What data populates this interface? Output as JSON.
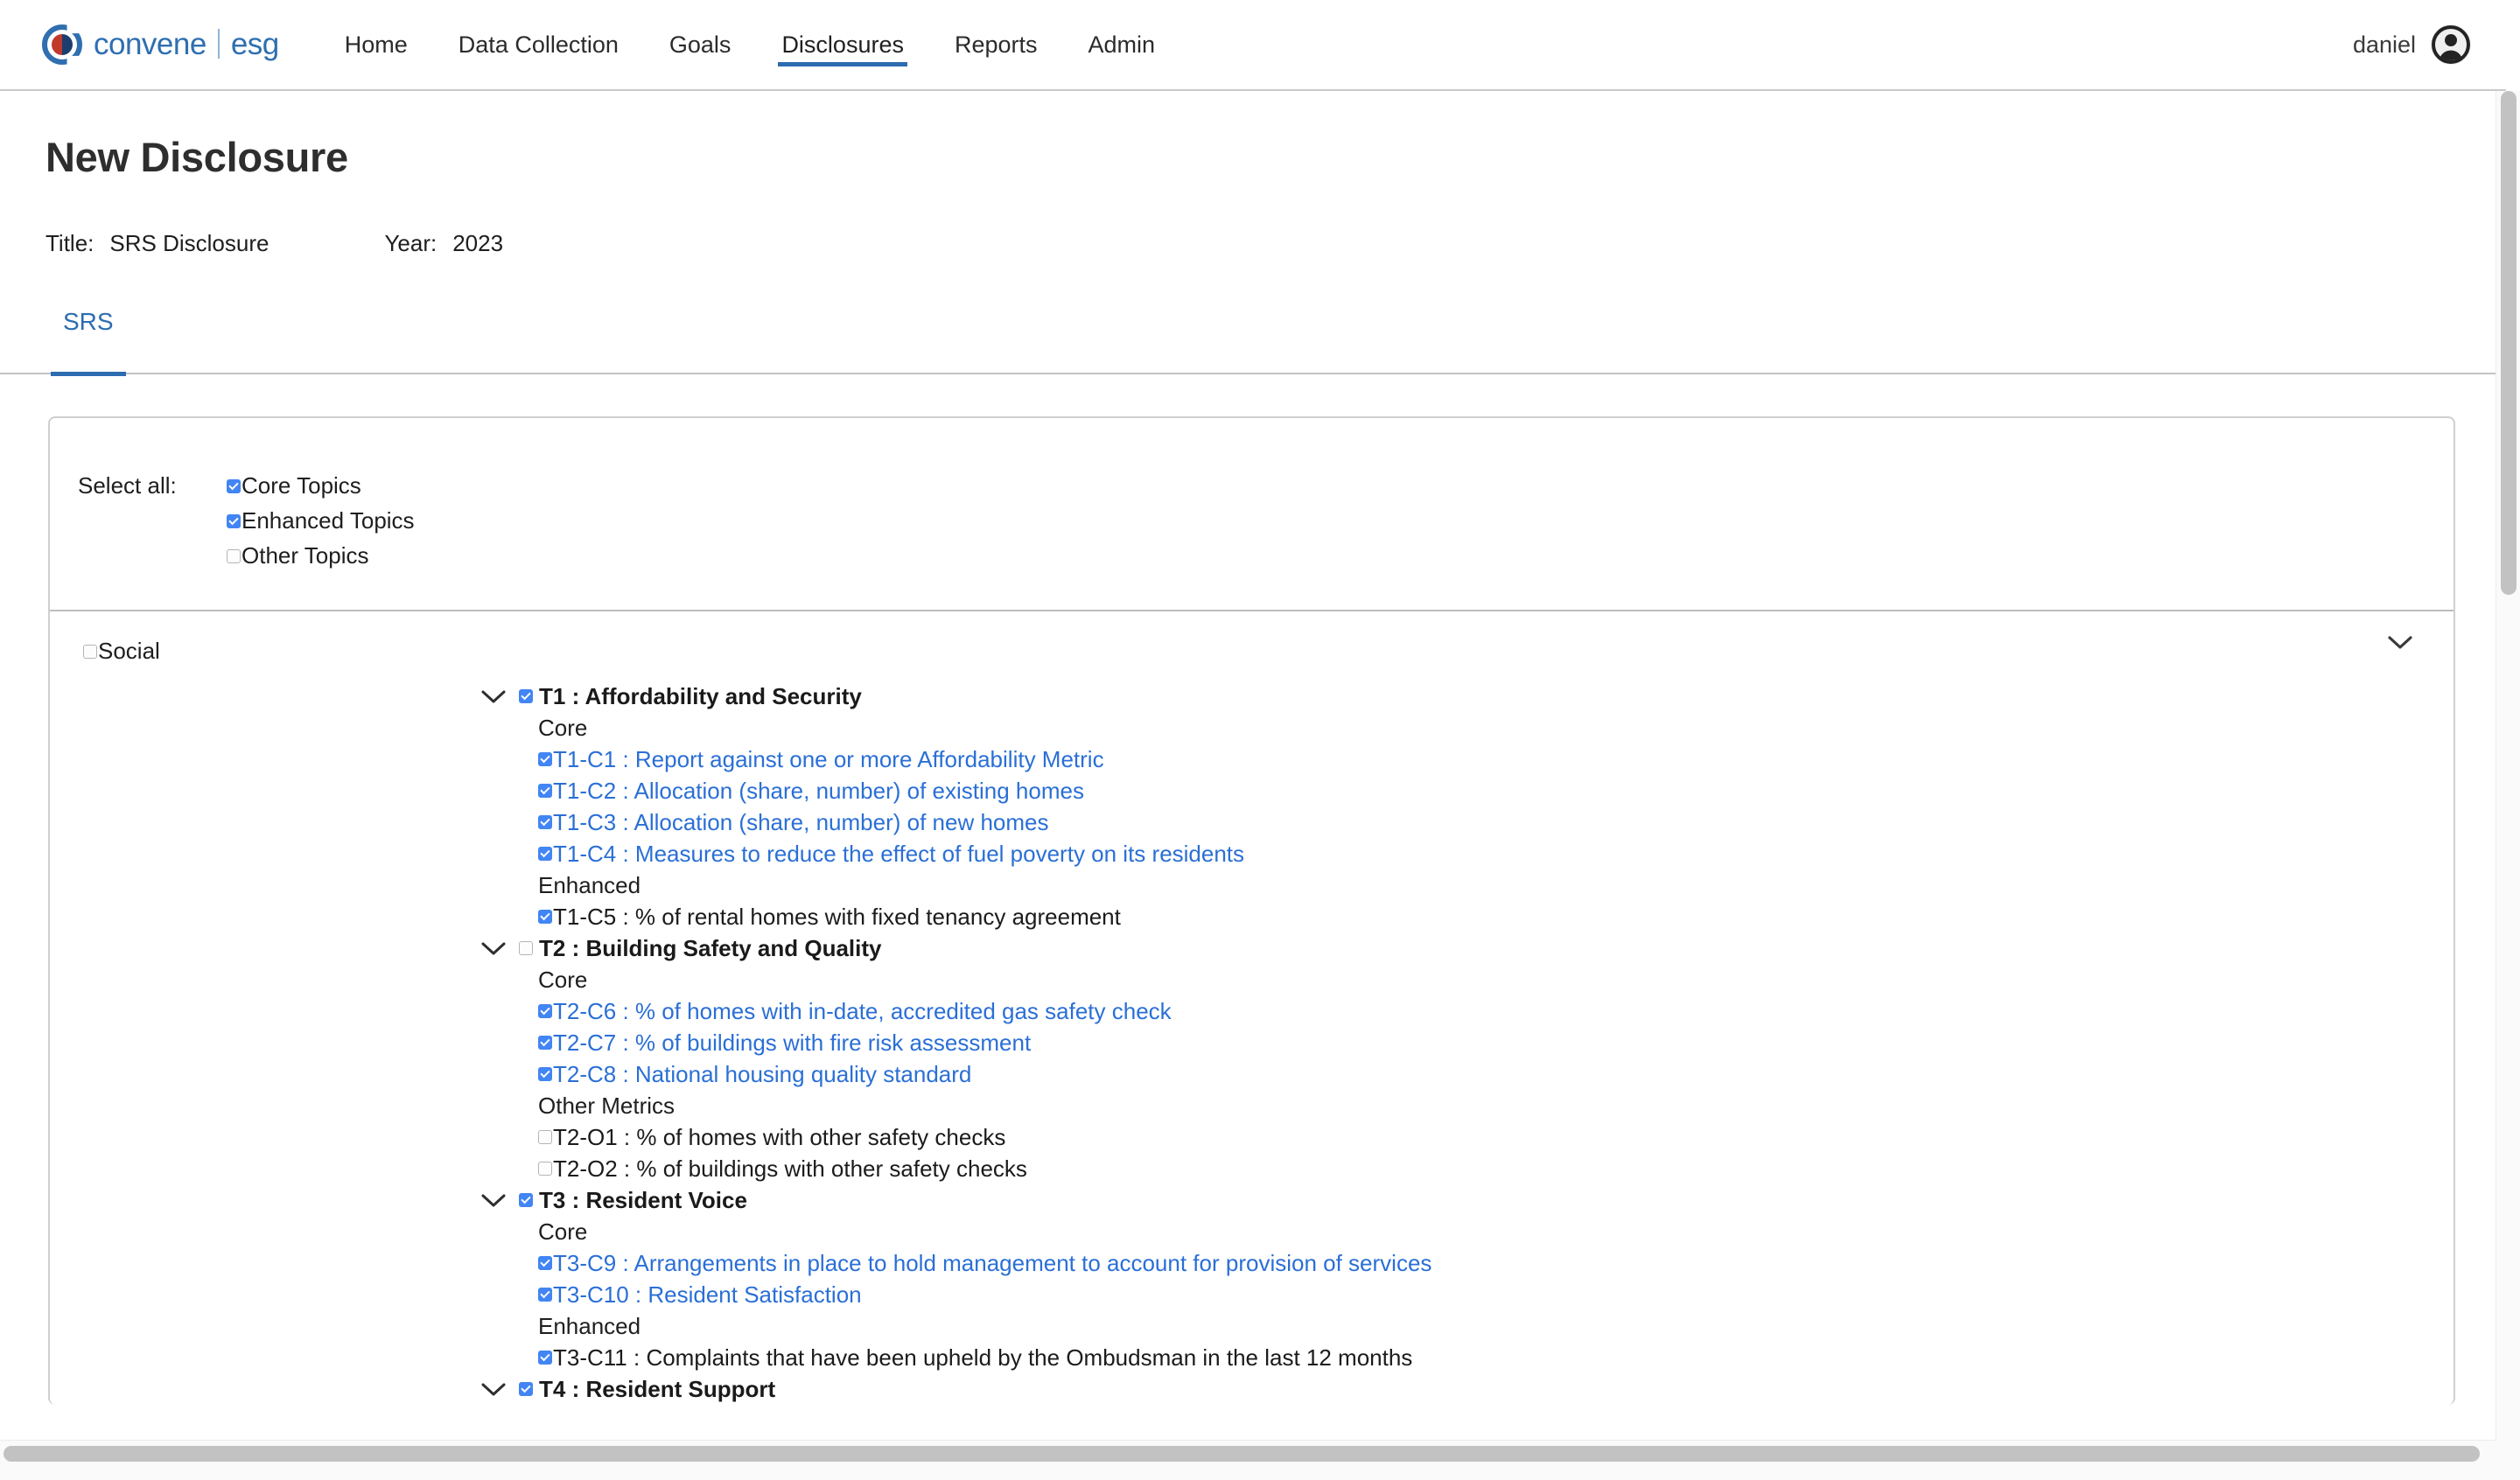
{
  "header": {
    "brand": {
      "name": "convene",
      "suffix": "esg"
    },
    "nav": [
      {
        "label": "Home",
        "active": false
      },
      {
        "label": "Data Collection",
        "active": false
      },
      {
        "label": "Goals",
        "active": false
      },
      {
        "label": "Disclosures",
        "active": true
      },
      {
        "label": "Reports",
        "active": false
      },
      {
        "label": "Admin",
        "active": false
      }
    ],
    "user": {
      "name": "daniel",
      "avatar_icon": "user-avatar-icon"
    }
  },
  "page": {
    "title": "New Disclosure",
    "title_label": "Title:",
    "title_value": "SRS Disclosure",
    "year_label": "Year:",
    "year_value": "2023"
  },
  "tabs": [
    {
      "label": "SRS",
      "active": true
    }
  ],
  "select_all": {
    "label": "Select all:",
    "options": [
      {
        "label": "Core Topics",
        "checked": true
      },
      {
        "label": "Enhanced Topics",
        "checked": true
      },
      {
        "label": "Other Topics",
        "checked": false
      }
    ]
  },
  "group": {
    "label": "Social",
    "checked": false,
    "chevron_icon": "chevron-down-icon",
    "topics": [
      {
        "title": "T1 : Affordability and Security",
        "checked": true,
        "expanded": true,
        "sections": [
          {
            "heading": "Core",
            "metrics": [
              {
                "label": "T1-C1 : Report against one or more Affordability Metric",
                "checked": true,
                "link": true
              },
              {
                "label": "T1-C2 : Allocation (share, number) of existing homes",
                "checked": true,
                "link": true
              },
              {
                "label": "T1-C3 : Allocation (share, number) of new homes",
                "checked": true,
                "link": true
              },
              {
                "label": "T1-C4 : Measures to reduce the effect of fuel poverty on its residents",
                "checked": true,
                "link": true
              }
            ]
          },
          {
            "heading": "Enhanced",
            "metrics": [
              {
                "label": "T1-C5 : % of rental homes with fixed tenancy agreement",
                "checked": true,
                "link": false
              }
            ]
          }
        ]
      },
      {
        "title": "T2 : Building Safety and Quality",
        "checked": false,
        "expanded": true,
        "sections": [
          {
            "heading": "Core",
            "metrics": [
              {
                "label": "T2-C6 : % of homes with in-date, accredited gas safety check",
                "checked": true,
                "link": true
              },
              {
                "label": "T2-C7 : % of buildings with fire risk assessment",
                "checked": true,
                "link": true
              },
              {
                "label": "T2-C8 : National housing quality standard",
                "checked": true,
                "link": true
              }
            ]
          },
          {
            "heading": "Other Metrics",
            "metrics": [
              {
                "label": "T2-O1 : % of homes with other safety checks",
                "checked": false,
                "link": false
              },
              {
                "label": "T2-O2 : % of buildings with other safety checks",
                "checked": false,
                "link": false
              }
            ]
          }
        ]
      },
      {
        "title": "T3 : Resident Voice",
        "checked": true,
        "expanded": true,
        "sections": [
          {
            "heading": "Core",
            "metrics": [
              {
                "label": "T3-C9 : Arrangements in place to hold management to account for provision of services",
                "checked": true,
                "link": true
              },
              {
                "label": "T3-C10 : Resident Satisfaction",
                "checked": true,
                "link": true
              }
            ]
          },
          {
            "heading": "Enhanced",
            "metrics": [
              {
                "label": "T3-C11 : Complaints that have been upheld by the Ombudsman in the last 12 months",
                "checked": true,
                "link": false
              }
            ]
          }
        ]
      },
      {
        "title": "T4 : Resident Support",
        "checked": true,
        "expanded": true,
        "sections": []
      }
    ]
  },
  "colors": {
    "brand_blue": "#2f6fb0",
    "link_blue": "#2a6fd6",
    "checkbox_blue": "#4285f4",
    "tab_underline": "#2c6cb0"
  }
}
